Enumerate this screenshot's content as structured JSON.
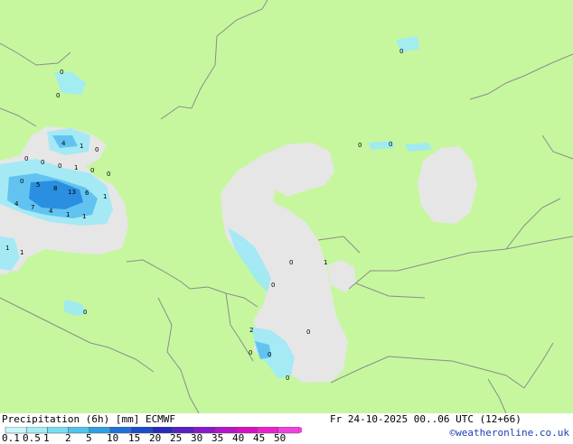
{
  "map": {
    "colors": {
      "land": "#c6f79e",
      "water": "#e6e6e6",
      "precip_light": "#9eeaf7",
      "precip_mid": "#62c3f0",
      "precip_heavy": "#2a8fe0",
      "border": "#8c8c8c"
    },
    "point_values": [
      "0",
      "0",
      "4",
      "1",
      "0",
      "0",
      "0",
      "0",
      "1",
      "0",
      "0",
      "5",
      "8",
      "13",
      "6",
      "1",
      "4",
      "7",
      "4",
      "1",
      "1",
      "1",
      "1",
      "0",
      "0",
      "0",
      "0",
      "0",
      "1",
      "0",
      "2",
      "0",
      "0",
      "0",
      "0",
      "0"
    ]
  },
  "legend": {
    "title": "Precipitation (6h) [mm] ECMWF",
    "valid_time": "Fr 24-10-2025 00..06 UTC (12+66)",
    "credit": "©weatheronline.co.uk",
    "ticks": [
      "0.1",
      "0.5",
      "1",
      "2",
      "5",
      "10",
      "15",
      "20",
      "25",
      "30",
      "35",
      "40",
      "45",
      "50"
    ],
    "scale_colors": [
      "#c8f5fa",
      "#a4ecf6",
      "#7adcf2",
      "#4fc3ee",
      "#2e9fe6",
      "#2070d8",
      "#1a4ccb",
      "#2a2ab8",
      "#5a20c0",
      "#8a18c8",
      "#b414c8",
      "#d410c4",
      "#ea20d0",
      "#f040e0"
    ]
  }
}
